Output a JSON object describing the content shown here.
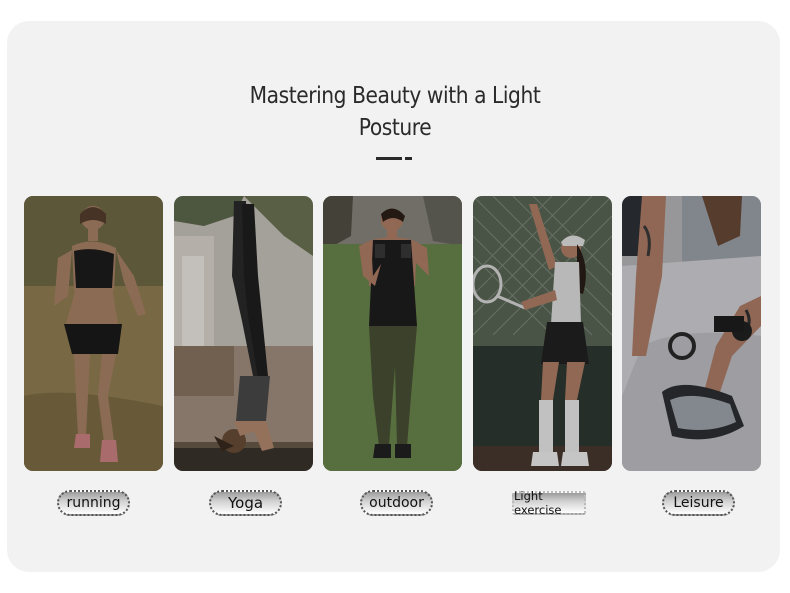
{
  "section": {
    "title_line1": "Mastering Beauty with a Light",
    "title_line2": "Posture"
  },
  "tiles": [
    {
      "label": "running"
    },
    {
      "label": "Yoga"
    },
    {
      "label": "outdoor"
    },
    {
      "label": "Light exercise"
    },
    {
      "label": "Leisure"
    }
  ]
}
